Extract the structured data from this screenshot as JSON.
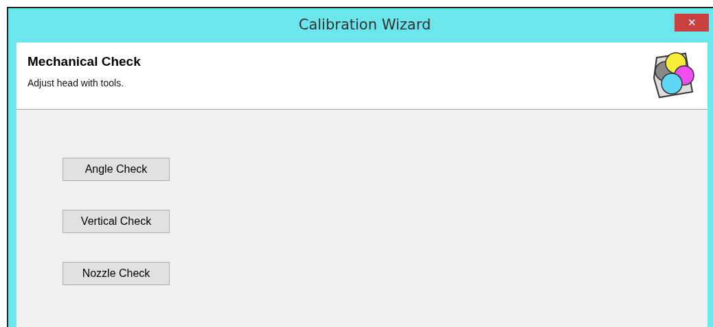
{
  "window": {
    "title": "Calibration Wizard",
    "close": "✕"
  },
  "header": {
    "title": "Mechanical Check",
    "subtitle": "Adjust head with tools."
  },
  "buttons": [
    {
      "label": "Angle Check"
    },
    {
      "label": "Vertical Check"
    },
    {
      "label": "Nozzle Check"
    }
  ]
}
